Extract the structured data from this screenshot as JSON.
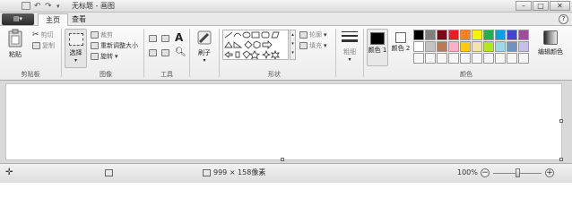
{
  "window": {
    "title": "无标题 - 画图",
    "minimize_glyph": "–",
    "maximize_glyph": "□",
    "close_glyph": "✕"
  },
  "app_button": {
    "label": "▤▾"
  },
  "tabs": [
    {
      "label": "主页",
      "active": true
    },
    {
      "label": "查看",
      "active": false
    }
  ],
  "help": {
    "label": "?"
  },
  "clipboard": {
    "paste_label": "粘贴",
    "cut_label": "剪切",
    "copy_label": "复制",
    "group_label": "剪贴板"
  },
  "image": {
    "select_label": "选择",
    "crop_label": "裁剪",
    "resize_label": "重新调整大小",
    "rotate_label": "旋转",
    "group_label": "图像"
  },
  "tools": {
    "text_glyph": "A",
    "group_label": "工具"
  },
  "brushes": {
    "label": "刷子"
  },
  "shapes": {
    "outline_label": "轮廓",
    "fill_label": "填充",
    "group_label": "形状"
  },
  "size": {
    "label": "粗细"
  },
  "colors": {
    "color1_label": "颜色 1",
    "color2_label": "颜色 2",
    "edit_label": "编辑颜色",
    "group_label": "颜色",
    "color1_value": "#000000",
    "color2_value": "#ffffff",
    "palette_row1": [
      "#000000",
      "#7f7f7f",
      "#880015",
      "#ed1c24",
      "#ff7f27",
      "#fff200",
      "#22b14c",
      "#00a2e8",
      "#3f48cc",
      "#a349a4"
    ],
    "palette_row2": [
      "#ffffff",
      "#c3c3c3",
      "#b97a57",
      "#ffaec9",
      "#ffc90e",
      "#efe4b0",
      "#b5e61d",
      "#99d9ea",
      "#7092be",
      "#c8bfe7"
    ]
  },
  "status": {
    "canvas_size": "999 × 158像素",
    "zoom": "100%",
    "add_glyph": "✛",
    "zoom_out_glyph": "−",
    "zoom_in_glyph": "+"
  }
}
